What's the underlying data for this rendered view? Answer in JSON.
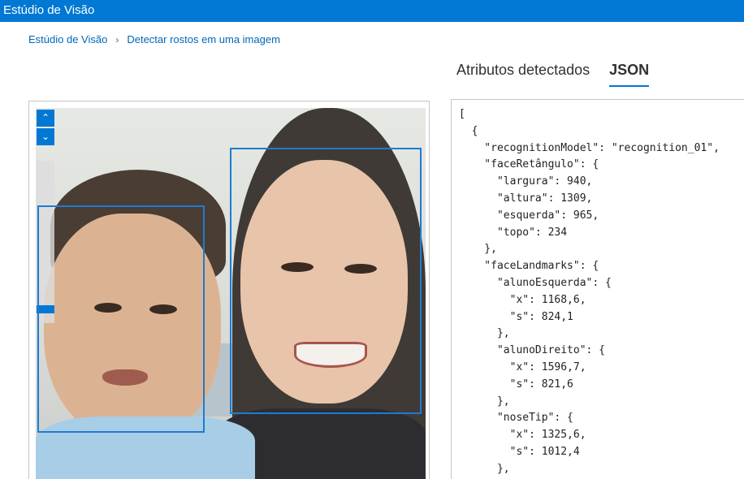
{
  "header": {
    "title": "Estúdio de Visão"
  },
  "breadcrumb": {
    "home": "Estúdio de Visão",
    "separator": "›",
    "current": "Detectar rostos em uma imagem"
  },
  "tabs": [
    {
      "label": "Atributos detectados",
      "active": false
    },
    {
      "label": "JSON",
      "active": true
    }
  ],
  "viewer": {
    "zoom_in_icon": "chevron-up-icon",
    "zoom_out_icon": "chevron-down-icon",
    "zoom_in_symbol": "⌃",
    "zoom_out_symbol": "⌄",
    "faces_detected": 2
  },
  "json_lines": [
    "[",
    "  {",
    "    \"recognitionModel\": \"recognition_01\",",
    "    \"faceRetângulo\": {",
    "      \"largura\": 940,",
    "      \"altura\": 1309,",
    "      \"esquerda\": 965,",
    "      \"topo\": 234",
    "    },",
    "    \"faceLandmarks\": {",
    "      \"alunoEsquerda\": {",
    "        \"x\": 1168,6,",
    "        \"s\": 824,1",
    "      },",
    "      \"alunoDireito\": {",
    "        \"x\": 1596,7,",
    "        \"s\": 821,6",
    "      },",
    "      \"noseTip\": {",
    "        \"x\": 1325,6,",
    "        \"s\": 1012,4",
    "      },"
  ],
  "colors": {
    "brand": "#0078d4",
    "link": "#0067b8",
    "face_box": "#1e7bd2"
  }
}
